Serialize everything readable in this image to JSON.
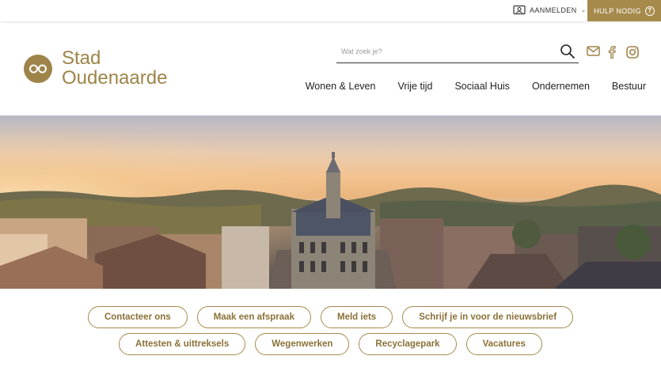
{
  "topbar": {
    "login_label": "AANMELDEN",
    "help_label": "HULP NODIG"
  },
  "brand": {
    "line1": "Stad",
    "line2": "Oudenaarde",
    "color": "#9e8449"
  },
  "search": {
    "placeholder": "Wat zoek je?"
  },
  "social": [
    "mail-icon",
    "facebook-icon",
    "instagram-icon"
  ],
  "nav": {
    "items": [
      "Wonen & Leven",
      "Vrije tijd",
      "Sociaal Huis",
      "Ondernemen",
      "Bestuur"
    ]
  },
  "quicklinks": {
    "row1": [
      "Contacteer ons",
      "Maak een afspraak",
      "Meld iets",
      "Schrijf je in voor de nieuwsbrief"
    ],
    "row2": [
      "Attesten & uittreksels",
      "Wegenwerken",
      "Recyclagepark",
      "Vacatures"
    ]
  },
  "colors": {
    "accent": "#a68a4b",
    "accent_text": "#8a7138"
  }
}
